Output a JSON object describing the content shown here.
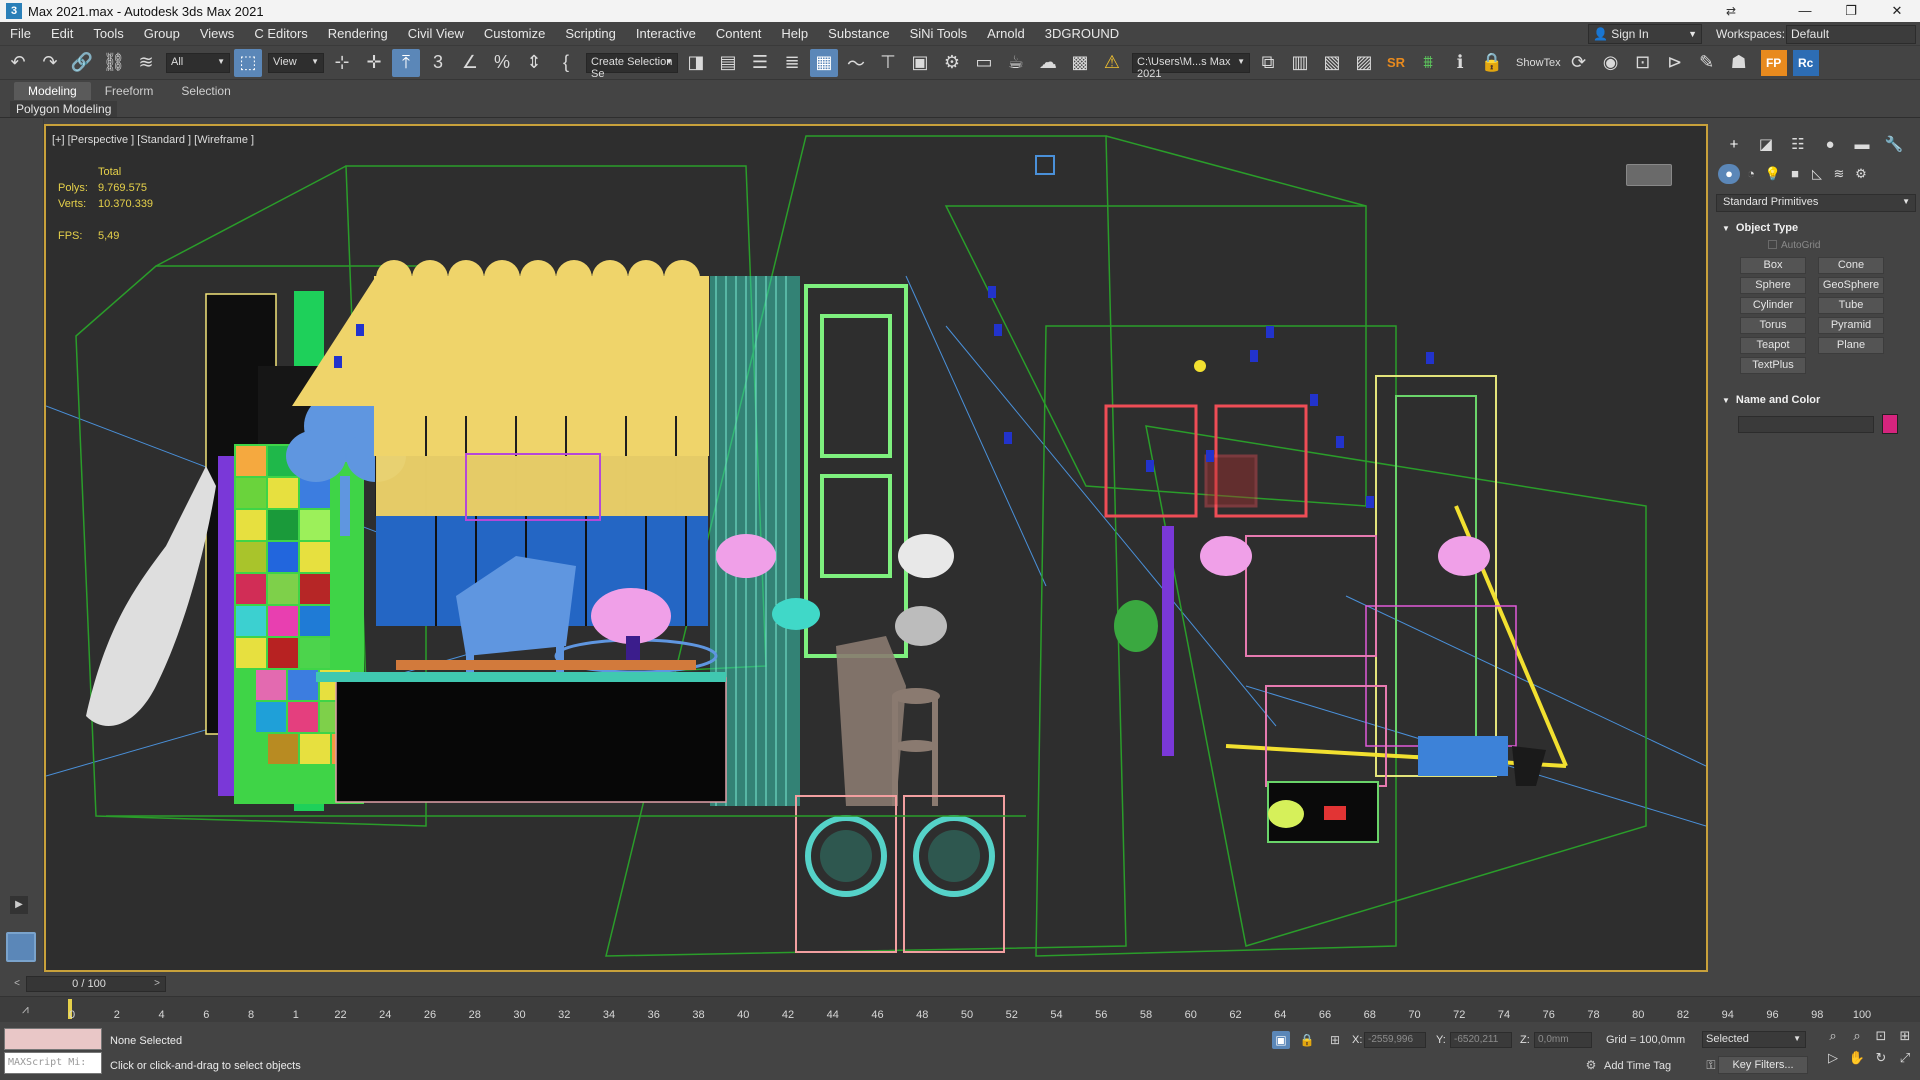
{
  "window": {
    "title": "Max 2021.max - Autodesk 3ds Max 2021",
    "minimize": "—",
    "restore": "❐",
    "close": "✕"
  },
  "menu": [
    "File",
    "Edit",
    "Tools",
    "Group",
    "Views",
    "C Editors",
    "Rendering",
    "Civil View",
    "Customize",
    "Scripting",
    "Interactive",
    "Content",
    "Help",
    "Substance",
    "SiNi Tools",
    "Arnold",
    "3DGROUND"
  ],
  "account": {
    "sign_in": "Sign In",
    "workspaces_label": "Workspaces:",
    "workspace_value": "Default"
  },
  "toolbar": {
    "selection_filter": "All",
    "ref_coord": "View",
    "named_selection": "Create Selection Se",
    "project_path": "C:\\Users\\M...s Max 2021",
    "showtex": "ShowTex",
    "sr": "SR",
    "fp": "FP",
    "rc": "Rc"
  },
  "ribbon": {
    "tabs": [
      "Modeling",
      "Freeform",
      "Selection"
    ],
    "panel": "Polygon Modeling"
  },
  "viewport": {
    "label": "[+] [Perspective ] [Standard ] [Wireframe ]",
    "stats_header": "Total",
    "polys_label": "Polys:",
    "polys_value": "9.769.575",
    "verts_label": "Verts:",
    "verts_value": "10.370.339",
    "fps_label": "FPS:",
    "fps_value": "5,49"
  },
  "command_panel": {
    "category": "Standard Primitives",
    "object_type_title": "Object Type",
    "autogrid": "AutoGrid",
    "primitives": [
      "Box",
      "Cone",
      "Sphere",
      "GeoSphere",
      "Cylinder",
      "Tube",
      "Torus",
      "Pyramid",
      "Teapot",
      "Plane",
      "TextPlus"
    ],
    "name_color_title": "Name and Color",
    "object_color": "#d6247e"
  },
  "timeline": {
    "frame_display": "0 / 100",
    "ticks": [
      "0",
      "2",
      "4",
      "6",
      "8",
      "1",
      "22",
      "24",
      "26",
      "28",
      "30",
      "32",
      "34",
      "36",
      "38",
      "40",
      "42",
      "44",
      "46",
      "48",
      "50",
      "52",
      "54",
      "56",
      "58",
      "60",
      "62",
      "64",
      "66",
      "68",
      "70",
      "72",
      "74",
      "76",
      "78",
      "80",
      "82",
      "94",
      "96",
      "98",
      "100"
    ]
  },
  "status": {
    "maxscript_placeholder": "MAXScript Mi:",
    "selection": "None Selected",
    "prompt": "Click or click-and-drag to select objects",
    "x_label": "X:",
    "x_value": "-2559,996",
    "y_label": "Y:",
    "y_value": "-6520,211",
    "z_label": "Z:",
    "z_value": "0,0mm",
    "grid": "Grid = 100,0mm",
    "selected_set": "Selected",
    "add_time_tag": "Add Time Tag",
    "key_filters": "Key Filters..."
  }
}
